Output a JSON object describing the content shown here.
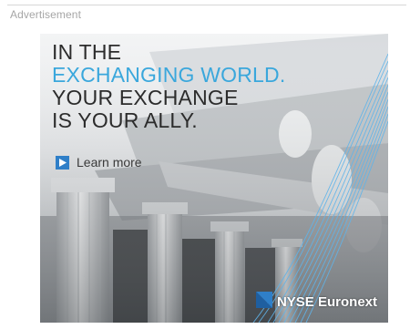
{
  "page": {
    "ad_label": "Advertisement"
  },
  "banner": {
    "headline_lines": [
      "IN THE",
      "EXCHANGING WORLD.",
      "YOUR EXCHANGE",
      "IS YOUR ALLY."
    ],
    "learn_more_label": "Learn more",
    "brand_name": "NYSE Euronext",
    "colors": {
      "accent": "#3aa7dc",
      "headline": "#2c2c2c",
      "play_button": "#2f7fc8"
    },
    "icons": [
      "play-icon",
      "nyse-logo-icon"
    ]
  }
}
